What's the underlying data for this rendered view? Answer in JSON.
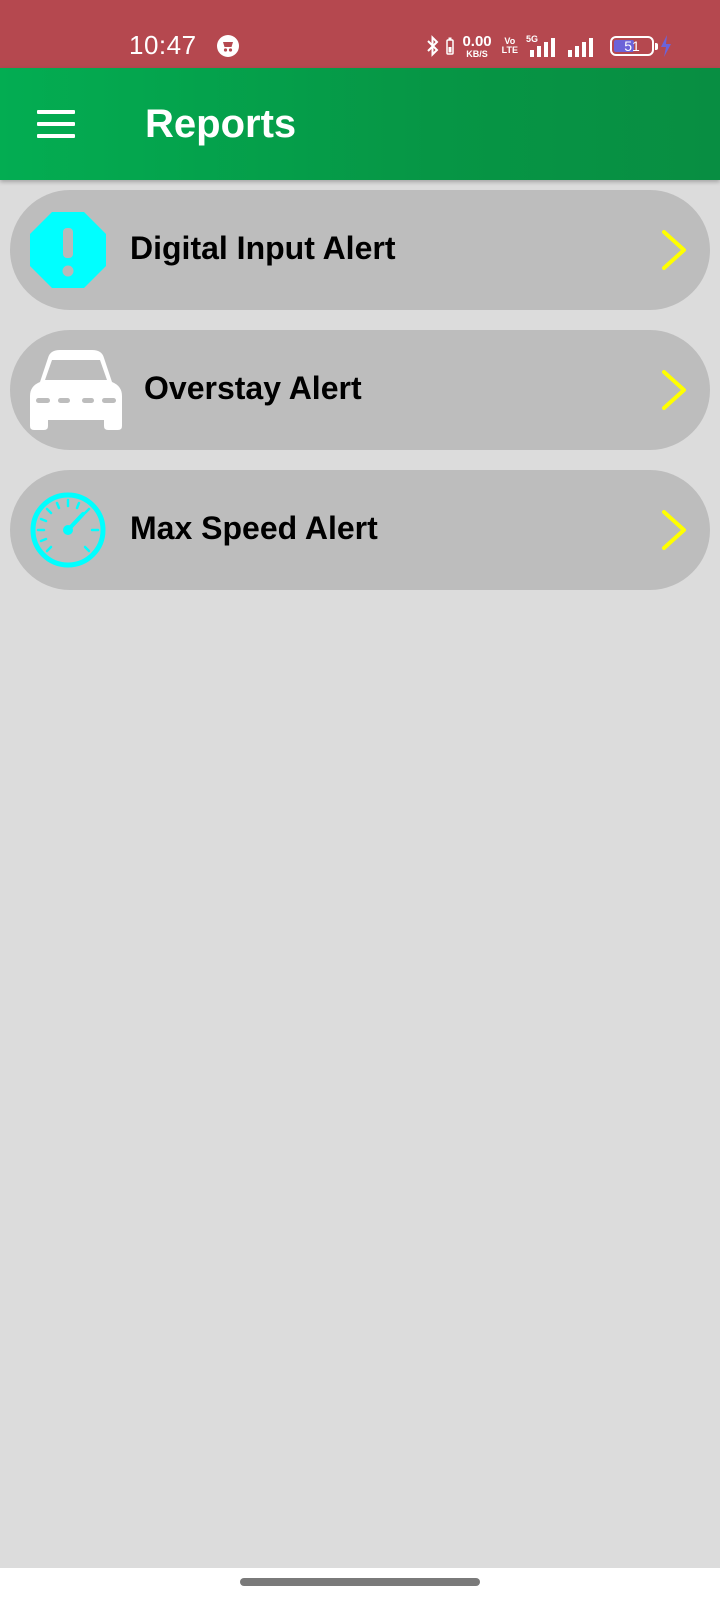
{
  "status_bar": {
    "time": "10:47",
    "net_speed_value": "0.00",
    "net_speed_unit": "KB/S",
    "volte_line1": "Vo",
    "volte_line2": "LTE",
    "network_type": "5G",
    "battery_level": "51",
    "charging": true
  },
  "app_bar": {
    "title": "Reports",
    "menu_icon": "hamburger-menu-icon"
  },
  "report_items": [
    {
      "label": "Digital Input Alert",
      "icon": "alert-octagon-icon",
      "icon_color": "#00ffff"
    },
    {
      "label": "Overstay Alert",
      "icon": "car-icon",
      "icon_color": "#ffffff"
    },
    {
      "label": "Max Speed Alert",
      "icon": "speedometer-icon",
      "icon_color": "#00ffff"
    }
  ],
  "chevron_icon": "chevron-right-icon",
  "colors": {
    "status_bar": "#b5484f",
    "app_bar": "#069645",
    "background": "#dcdcdc",
    "list_item": "#bdbdbd",
    "chevron": "#ffff00",
    "cyan_icon": "#00ffff"
  }
}
